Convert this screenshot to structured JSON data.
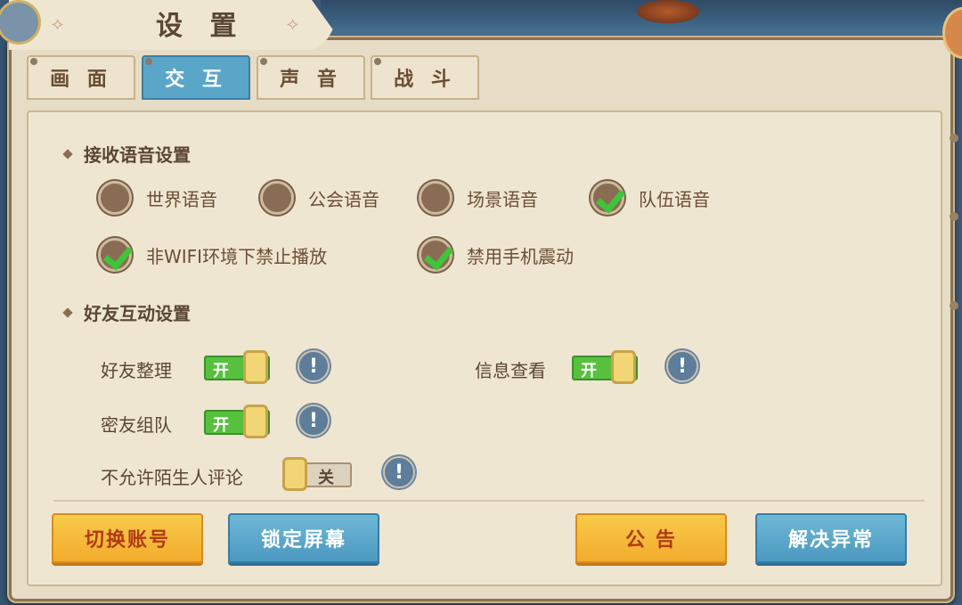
{
  "window": {
    "title": "设 置"
  },
  "tabs": [
    {
      "label": "画 面",
      "active": false
    },
    {
      "label": "交 互",
      "active": true
    },
    {
      "label": "声 音",
      "active": false
    },
    {
      "label": "战 斗",
      "active": false
    }
  ],
  "voice_section": {
    "title": "接收语音设置",
    "options": [
      {
        "label": "世界语音",
        "checked": false
      },
      {
        "label": "公会语音",
        "checked": false
      },
      {
        "label": "场景语音",
        "checked": false
      },
      {
        "label": "队伍语音",
        "checked": true
      },
      {
        "label": "非WIFI环境下禁止播放",
        "checked": true
      },
      {
        "label": "禁用手机震动",
        "checked": true
      }
    ]
  },
  "friend_section": {
    "title": "好友互动设置",
    "settings": [
      {
        "label": "好友整理",
        "state": "开",
        "on": true
      },
      {
        "label": "信息查看",
        "state": "开",
        "on": true
      },
      {
        "label": "密友组队",
        "state": "开",
        "on": true
      },
      {
        "label": "不允许陌生人评论",
        "state": "关",
        "on": false
      }
    ],
    "info_glyph": "!"
  },
  "buttons": {
    "switch_account": "切换账号",
    "lock_screen": "锁定屏幕",
    "notice": "公 告",
    "fix_issue": "解决异常"
  },
  "colors": {
    "tab_active": "#5aa6c9",
    "toggle_on": "#57c13e",
    "button_orange": "#f2ac2c",
    "button_blue": "#4b98c0",
    "panel_bg": "#efe6d2"
  },
  "icons": {
    "title_ornament": "ornament-icon",
    "info": "info-icon",
    "check": "checkmark-icon"
  }
}
